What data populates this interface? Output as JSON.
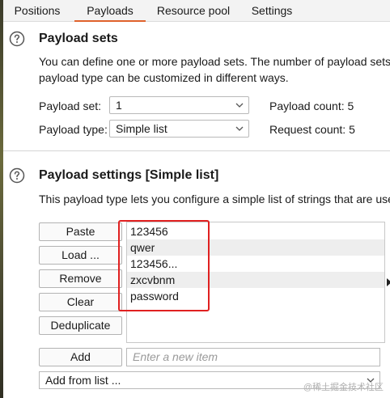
{
  "tabs": [
    {
      "label": "Positions",
      "active": false
    },
    {
      "label": "Payloads",
      "active": true
    },
    {
      "label": "Resource pool",
      "active": false
    },
    {
      "label": "Settings",
      "active": false
    }
  ],
  "payload_sets": {
    "title": "Payload sets",
    "description_line1": "You can define one or more payload sets. The number of payload sets",
    "description_line2": "payload type can be customized in different ways.",
    "payload_set_label": "Payload set:",
    "payload_set_value": "1",
    "payload_type_label": "Payload type:",
    "payload_type_value": "Simple list",
    "payload_count_label": "Payload count:",
    "payload_count_value": "5",
    "request_count_label": "Request count:",
    "request_count_value": "5"
  },
  "payload_settings": {
    "title": "Payload settings [Simple list]",
    "description": "This payload type lets you configure a simple list of strings that are use",
    "buttons": {
      "paste": "Paste",
      "load": "Load ...",
      "remove": "Remove",
      "clear": "Clear",
      "deduplicate": "Deduplicate",
      "add": "Add"
    },
    "list_items": [
      "123456",
      "qwer",
      "123456...",
      "zxcvbnm",
      "password"
    ],
    "new_item_placeholder": "Enter a new item",
    "add_from_list": "Add from list ..."
  },
  "watermark": "@稀土掘金技术社区",
  "colors": {
    "active_tab_underline": "#e0632c",
    "highlight_box": "#e02020",
    "help_icon": "#555555"
  },
  "icons": {
    "help": "help-circle-icon",
    "dropdown": "chevron-down-icon"
  }
}
